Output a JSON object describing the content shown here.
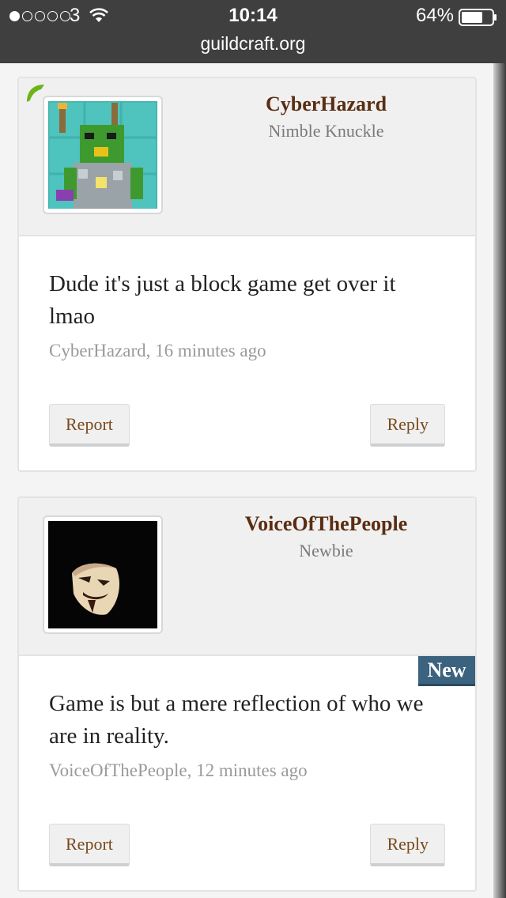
{
  "status_bar": {
    "carrier": "3",
    "time": "10:14",
    "battery": "64%",
    "url": "guildcraft.org",
    "signal_bars_filled": 1,
    "signal_bars_total": 5
  },
  "posts": [
    {
      "username": "CyberHazard",
      "user_title": "Nimble Knuckle",
      "avatar": "minecraft-skin-avatar",
      "message": "Dude it's just a block game get over it lmao",
      "byline": "CyberHazard, 16 minutes ago",
      "report_label": "Report",
      "reply_label": "Reply",
      "online": true
    },
    {
      "username": "VoiceOfThePeople",
      "user_title": "Newbie",
      "avatar": "guy-fawkes-mask-avatar",
      "message": "Game is but a mere reflection of who we are in reality.",
      "byline": "VoiceOfThePeople, 12 minutes ago",
      "report_label": "Report",
      "reply_label": "Reply",
      "badge": "New"
    }
  ],
  "colors": {
    "username": "#5a2d12",
    "badge": "#3b627e",
    "online": "#6db31c"
  }
}
